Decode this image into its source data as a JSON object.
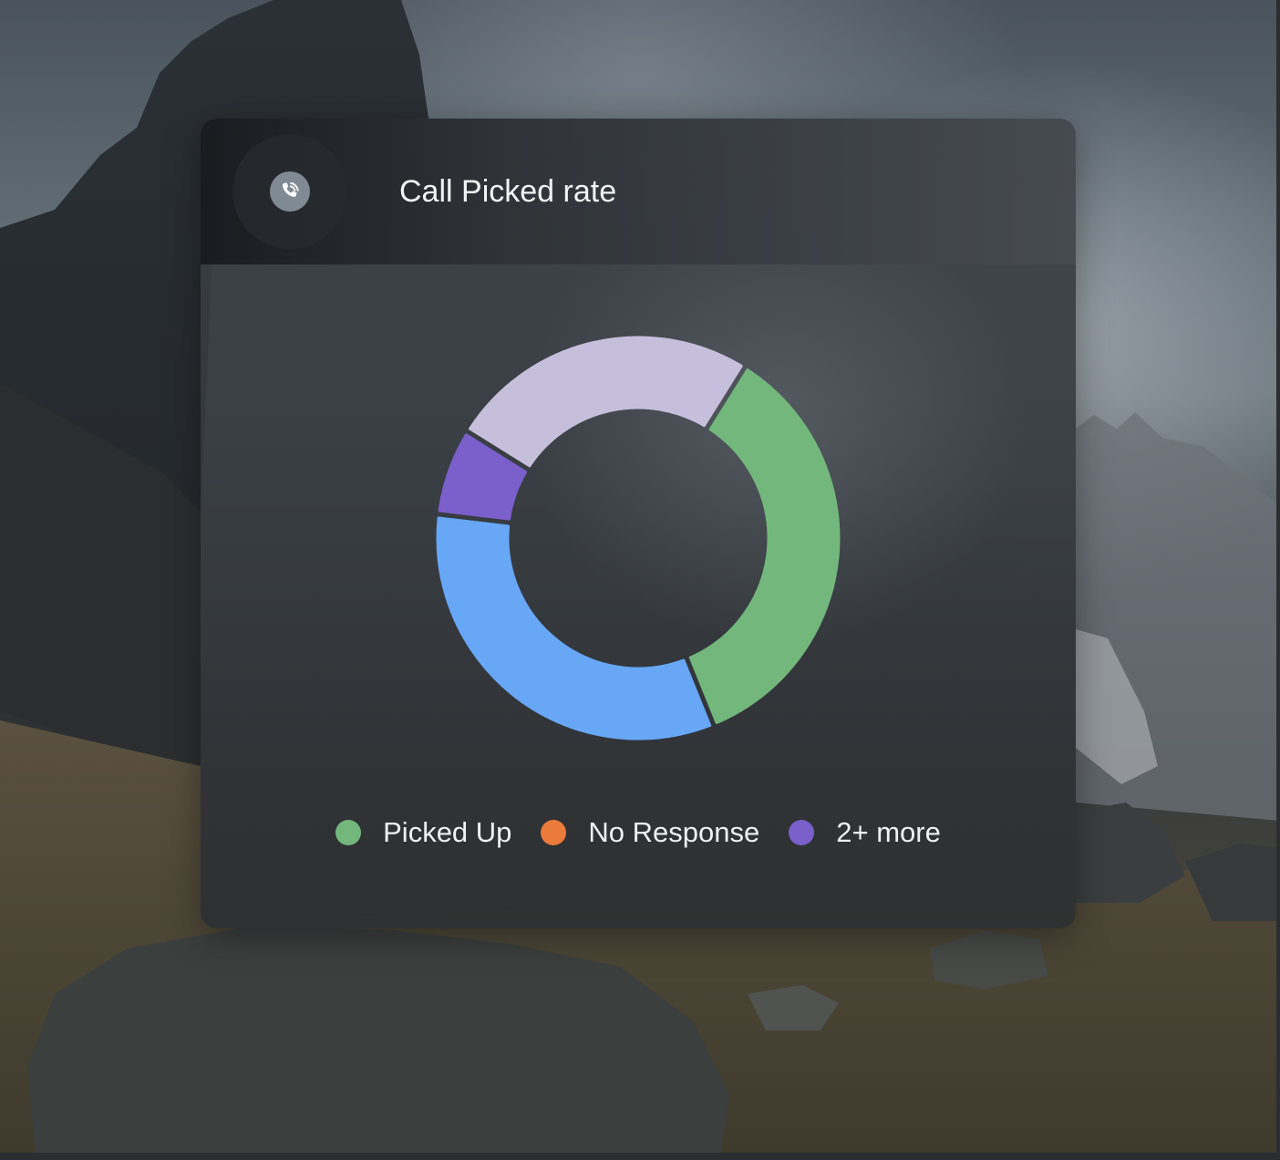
{
  "card": {
    "title": "Call Picked rate",
    "icon": "phone-call-icon"
  },
  "chart_data": {
    "type": "pie",
    "variant": "donut",
    "title": "Call Picked rate",
    "series": [
      {
        "name": "Picked Up",
        "value": 35,
        "color": "#73b77d"
      },
      {
        "name": "Unlabeled blue",
        "value": 33,
        "color": "#68a6f6"
      },
      {
        "name": "Unlabeled violet",
        "value": 7,
        "color": "#7b5fcb"
      },
      {
        "name": "Unlabeled lavender",
        "value": 25,
        "color": "#c6bfdc"
      }
    ],
    "start_angle_deg": -58,
    "legend": {
      "placement": "bottom",
      "items": [
        {
          "label": "Picked Up",
          "color": "#73b77d"
        },
        {
          "label": "No Response",
          "color": "#ea7b3a"
        },
        {
          "label": "2+ more",
          "color": "#7b5fcb"
        }
      ]
    }
  }
}
